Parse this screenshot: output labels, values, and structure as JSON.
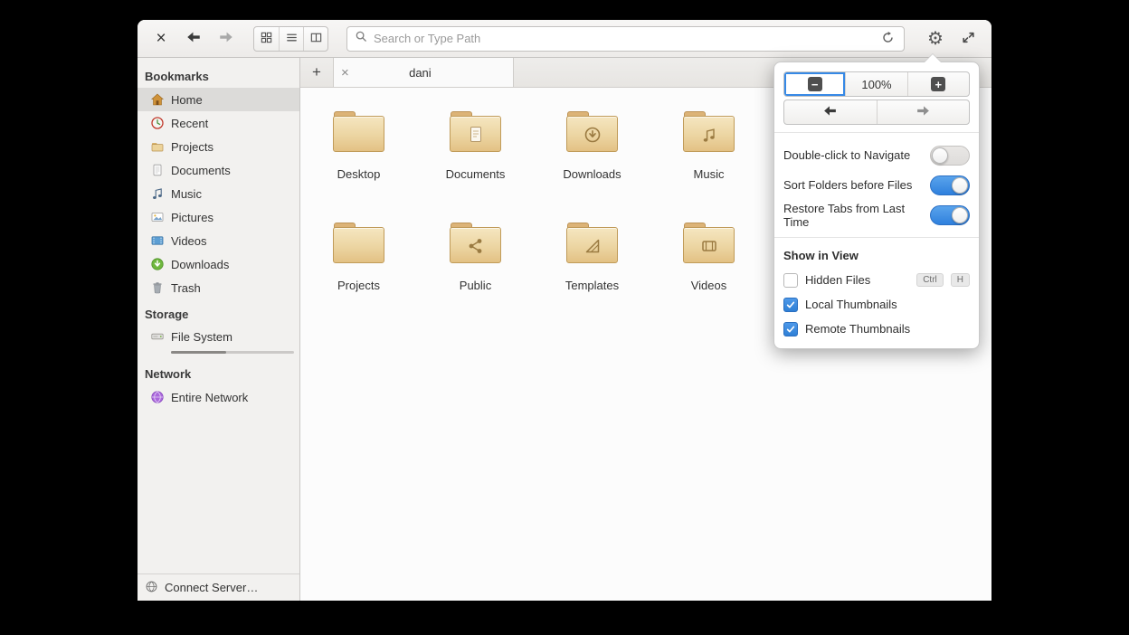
{
  "colors": {
    "accent": "#3689e6",
    "folder_light": "#f5e6c0",
    "folder_dark": "#e3c184"
  },
  "headerbar": {
    "close_label": "×",
    "search_placeholder": "Search or Type Path"
  },
  "tabbar": {
    "new_tab_label": "+",
    "tabs": [
      {
        "label": "dani",
        "close_label": "×",
        "active": true
      }
    ]
  },
  "sidebar": {
    "sections": [
      {
        "label": "Bookmarks",
        "items": [
          {
            "label": "Home",
            "icon": "home-icon",
            "selected": true
          },
          {
            "label": "Recent",
            "icon": "recent-clock-icon"
          },
          {
            "label": "Projects",
            "icon": "folder-icon"
          },
          {
            "label": "Documents",
            "icon": "document-icon"
          },
          {
            "label": "Music",
            "icon": "music-note-icon"
          },
          {
            "label": "Pictures",
            "icon": "image-icon"
          },
          {
            "label": "Videos",
            "icon": "film-icon"
          },
          {
            "label": "Downloads",
            "icon": "download-icon"
          },
          {
            "label": "Trash",
            "icon": "trash-icon"
          }
        ]
      },
      {
        "label": "Storage",
        "items": [
          {
            "label": "File System",
            "icon": "harddrive-icon",
            "usage_percent": 45
          }
        ]
      },
      {
        "label": "Network",
        "items": [
          {
            "label": "Entire Network",
            "icon": "network-globe-icon"
          }
        ]
      }
    ],
    "connect_server_label": "Connect Server…"
  },
  "files": [
    {
      "label": "Desktop",
      "emblem": "none"
    },
    {
      "label": "Documents",
      "emblem": "document"
    },
    {
      "label": "Downloads",
      "emblem": "download"
    },
    {
      "label": "Music",
      "emblem": "music"
    },
    {
      "label": "Projects",
      "emblem": "none"
    },
    {
      "label": "Public",
      "emblem": "share"
    },
    {
      "label": "Templates",
      "emblem": "template"
    },
    {
      "label": "Videos",
      "emblem": "video"
    }
  ],
  "popover": {
    "zoom_level": "100%",
    "toggles": [
      {
        "label": "Double-click to Navigate",
        "on": false
      },
      {
        "label": "Sort Folders before Files",
        "on": true
      },
      {
        "label": "Restore Tabs from Last Time",
        "on": true
      }
    ],
    "show_in_view": {
      "header": "Show in View",
      "items": [
        {
          "label": "Hidden Files",
          "checked": false,
          "shortcut": [
            "Ctrl",
            "H"
          ]
        },
        {
          "label": "Local Thumbnails",
          "checked": true
        },
        {
          "label": "Remote Thumbnails",
          "checked": true
        }
      ]
    }
  }
}
